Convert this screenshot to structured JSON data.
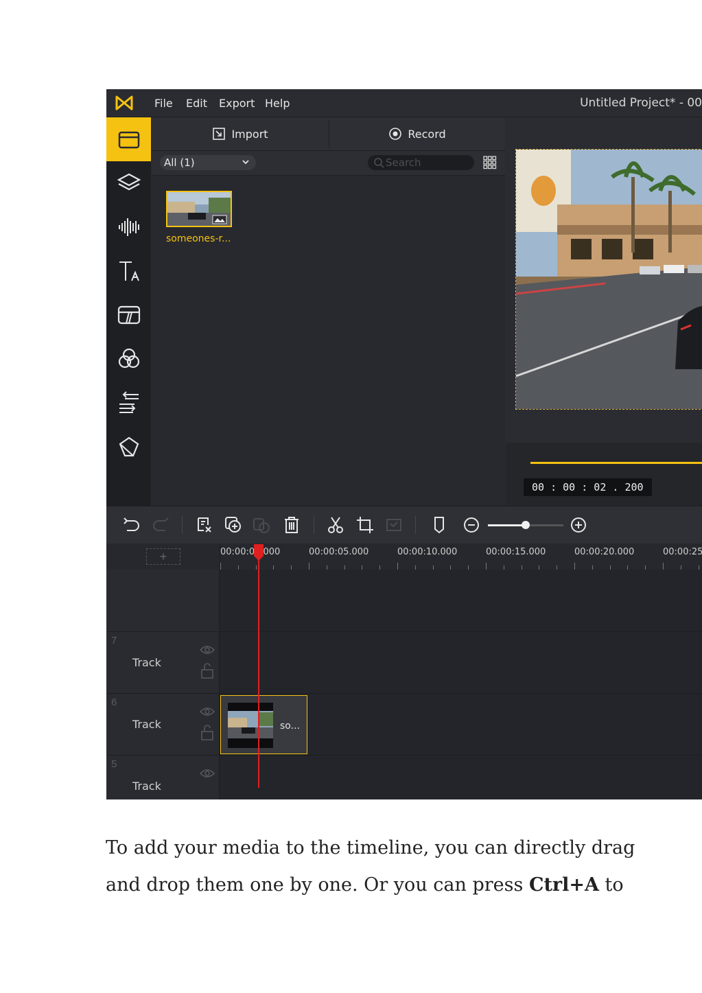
{
  "menubar": {
    "items": [
      "File",
      "Edit",
      "Export",
      "Help"
    ],
    "title": "Untitled Project* - 00"
  },
  "sidebar": {
    "items": [
      "media-icon",
      "layers-icon",
      "audio-icon",
      "text-icon",
      "transitions-icon",
      "filters-icon",
      "overlays-icon",
      "elements-icon"
    ],
    "active_index": 0
  },
  "media_panel": {
    "import_label": "Import",
    "record_label": "Record",
    "filter_value": "All (1)",
    "search_placeholder": "Search",
    "media_items": [
      {
        "name": "someones-r..."
      }
    ]
  },
  "preview": {
    "timecode": "00 : 00 : 02 . 200"
  },
  "timeline": {
    "ruler_labels": [
      "00:00:00.000",
      "00:00:05.000",
      "00:00:10.000",
      "00:00:15.000",
      "00:00:20.000",
      "00:00:25"
    ],
    "zoom_level": 0.5,
    "tracks": [
      {
        "number": "7",
        "name": "Track"
      },
      {
        "number": "6",
        "name": "Track",
        "clip_label": "so..."
      },
      {
        "number": "5",
        "name": "Track"
      }
    ]
  },
  "caption": {
    "line1": "To add your media to the timeline, you can directly drag",
    "line2_pre": "and drop them one by one. Or you can press ",
    "line2_bold": "Ctrl+A",
    "line2_post": " to"
  },
  "colors": {
    "accent": "#f5c211",
    "playhead": "#e02020",
    "panel": "#2a2b30"
  }
}
